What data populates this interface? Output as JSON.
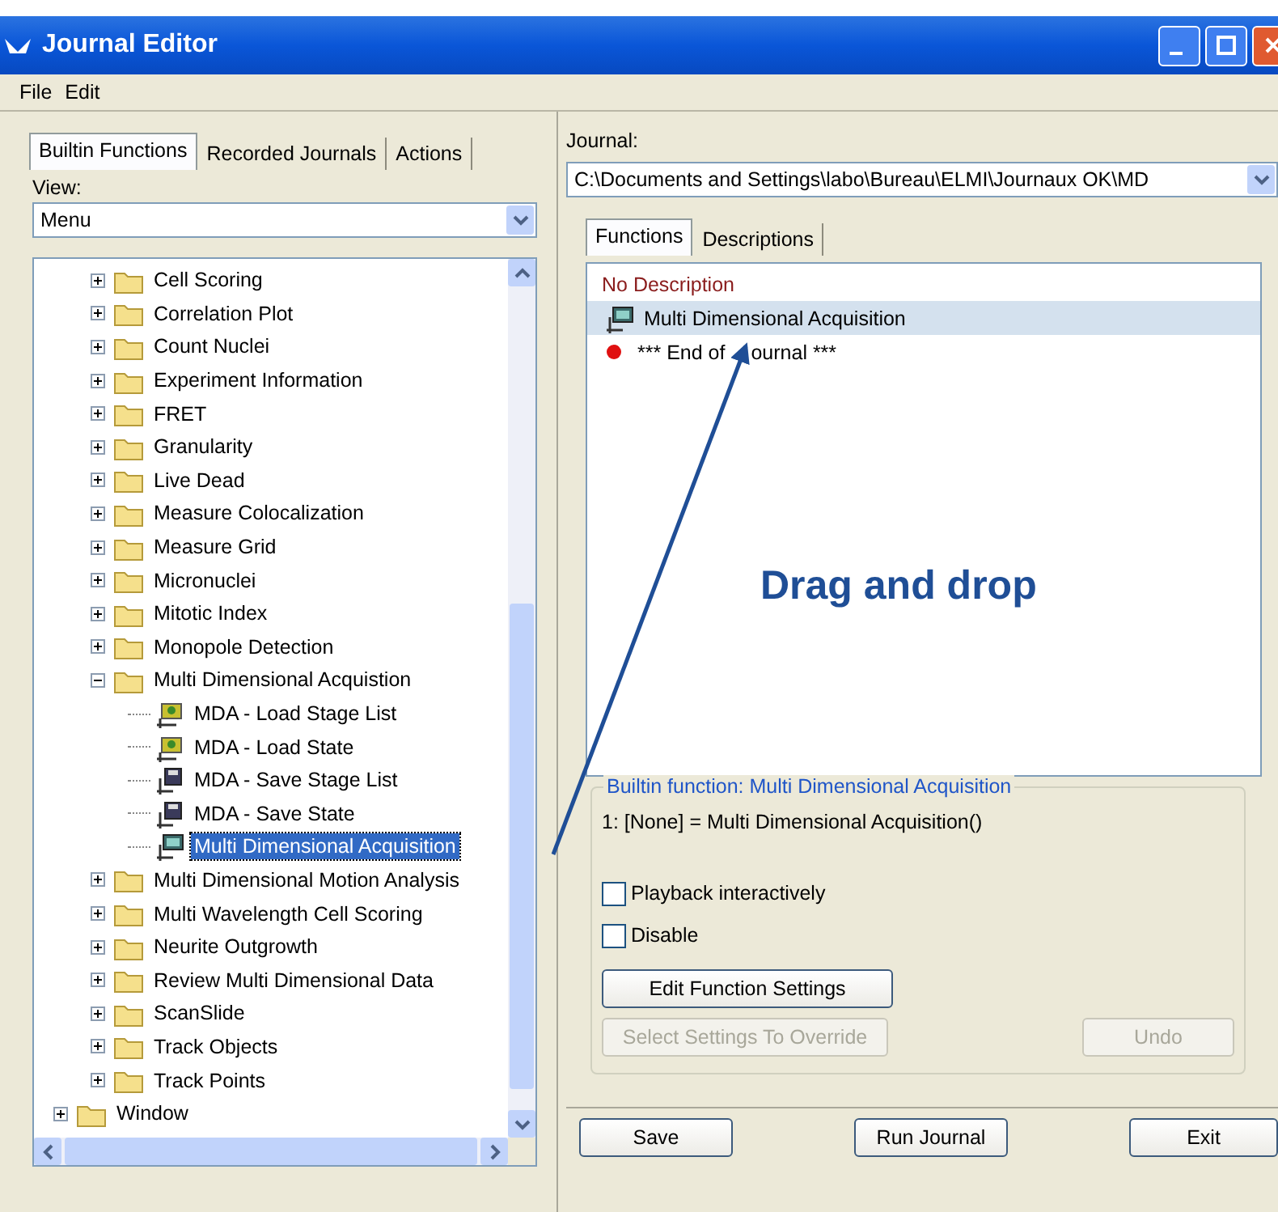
{
  "window": {
    "title": "Journal Editor"
  },
  "menu": [
    "File",
    "Edit"
  ],
  "left_tabs": [
    {
      "label": "Builtin Functions",
      "selected": true
    },
    {
      "label": "Recorded Journals",
      "selected": false
    },
    {
      "label": "Actions",
      "selected": false
    }
  ],
  "view": {
    "label": "View:",
    "value": "Menu"
  },
  "tree": [
    {
      "children": [
        {
          "label": "Cell Scoring",
          "expanded": false
        },
        {
          "label": "Correlation Plot",
          "expanded": false
        },
        {
          "label": "Count Nuclei",
          "expanded": false
        },
        {
          "label": "Experiment Information",
          "expanded": false
        },
        {
          "label": "FRET",
          "expanded": false
        },
        {
          "label": "Granularity",
          "expanded": false
        },
        {
          "label": "Live Dead",
          "expanded": false
        },
        {
          "label": "Measure Colocalization",
          "expanded": false
        },
        {
          "label": "Measure Grid",
          "expanded": false
        },
        {
          "label": "Micronuclei",
          "expanded": false
        },
        {
          "label": "Mitotic Index",
          "expanded": false
        },
        {
          "label": "Monopole Detection",
          "expanded": false
        },
        {
          "label": "Multi Dimensional Acquistion",
          "expanded": true,
          "children": [
            {
              "label": "MDA - Load Stage List",
              "kind": "load",
              "selected": false
            },
            {
              "label": "MDA - Load State",
              "kind": "load",
              "selected": false
            },
            {
              "label": "MDA - Save Stage List",
              "kind": "save",
              "selected": false
            },
            {
              "label": "MDA - Save State",
              "kind": "save",
              "selected": false
            },
            {
              "label": "Multi Dimensional Acquisition",
              "kind": "acquire",
              "selected": true
            }
          ]
        },
        {
          "label": "Multi Dimensional Motion Analysis",
          "expanded": false
        },
        {
          "label": "Multi Wavelength Cell Scoring",
          "expanded": false
        },
        {
          "label": "Neurite Outgrowth",
          "expanded": false
        },
        {
          "label": "Review Multi Dimensional Data",
          "expanded": false
        },
        {
          "label": "ScanSlide",
          "expanded": false
        },
        {
          "label": "Track Objects",
          "expanded": false
        },
        {
          "label": "Track Points",
          "expanded": false
        }
      ]
    },
    {
      "label": "Window",
      "expanded": false
    }
  ],
  "journal": {
    "label": "Journal:",
    "path": "C:\\Documents and Settings\\labo\\Bureau\\ELMI\\Journaux OK\\MD"
  },
  "right_tabs": [
    {
      "label": "Functions",
      "selected": true
    },
    {
      "label": "Descriptions",
      "selected": false
    }
  ],
  "journal_items": [
    {
      "kind": "header",
      "text": "No Description",
      "selected": false
    },
    {
      "kind": "function",
      "text": "Multi Dimensional Acquisition",
      "selected": true
    },
    {
      "kind": "end",
      "text": "*** End of",
      "text_after_arrow": "ournal ***",
      "selected": false
    }
  ],
  "details": {
    "title": "Builtin function: Multi Dimensional Acquisition",
    "signature": "1: [None] = Multi Dimensional Acquisition()",
    "options": [
      {
        "label": "Playback interactively",
        "checked": false
      },
      {
        "label": "Disable",
        "checked": false
      }
    ],
    "buttons": [
      {
        "label": "Edit Function Settings",
        "disabled": false
      },
      {
        "label": "Select Settings To Override",
        "disabled": true
      },
      {
        "label": "Undo",
        "disabled": true
      }
    ]
  },
  "footer_buttons": [
    "Save",
    "Run Journal",
    "Exit"
  ],
  "annotation": {
    "text": "Drag and drop"
  }
}
